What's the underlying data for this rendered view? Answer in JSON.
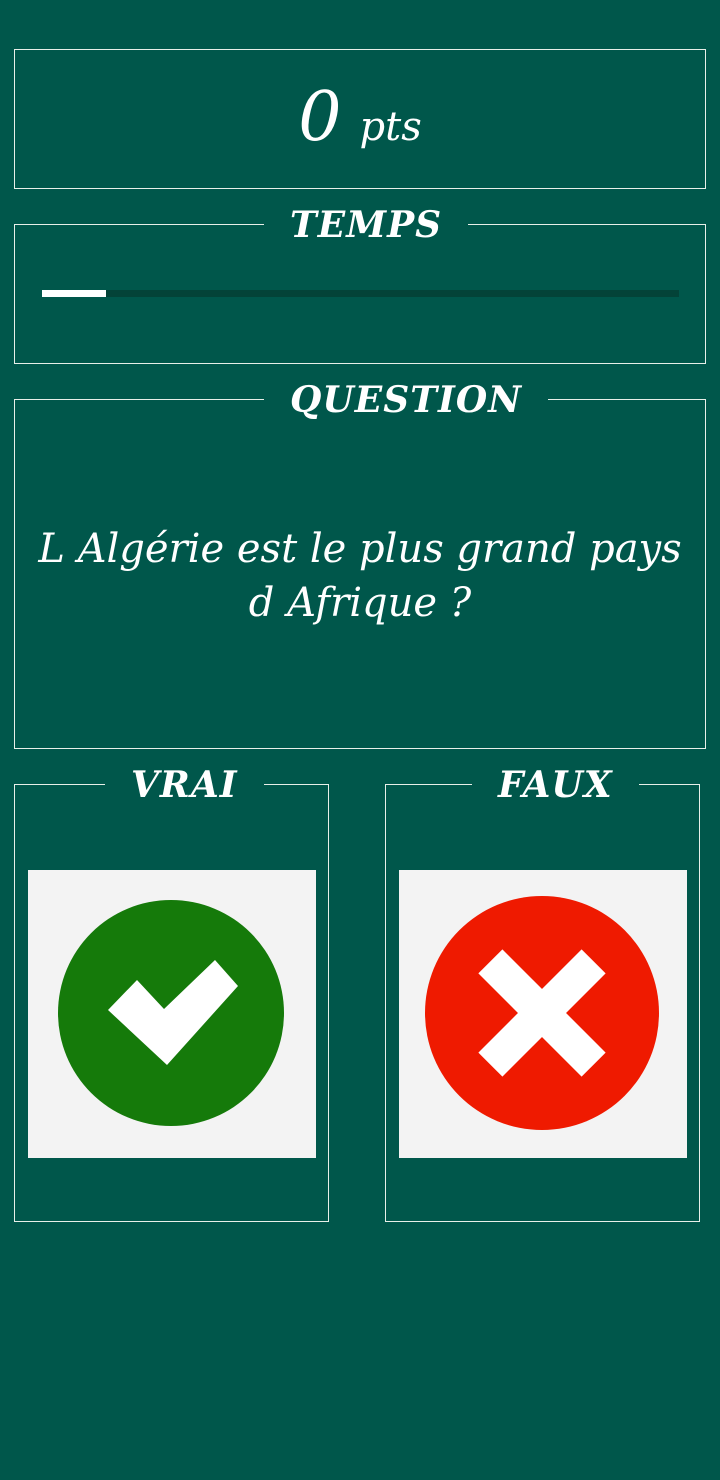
{
  "score": {
    "value": "0",
    "unit": "pts"
  },
  "timer": {
    "label": "TEMPS",
    "progress": 0.1
  },
  "question": {
    "label": "QUESTION",
    "text": "L Algérie est le plus grand pays d Afrique ?"
  },
  "answers": {
    "true": {
      "label": "VRAI",
      "icon": "check-circle-icon",
      "color": "#157a0a"
    },
    "false": {
      "label": "FAUX",
      "icon": "x-circle-icon",
      "color": "#ef1a00"
    }
  }
}
